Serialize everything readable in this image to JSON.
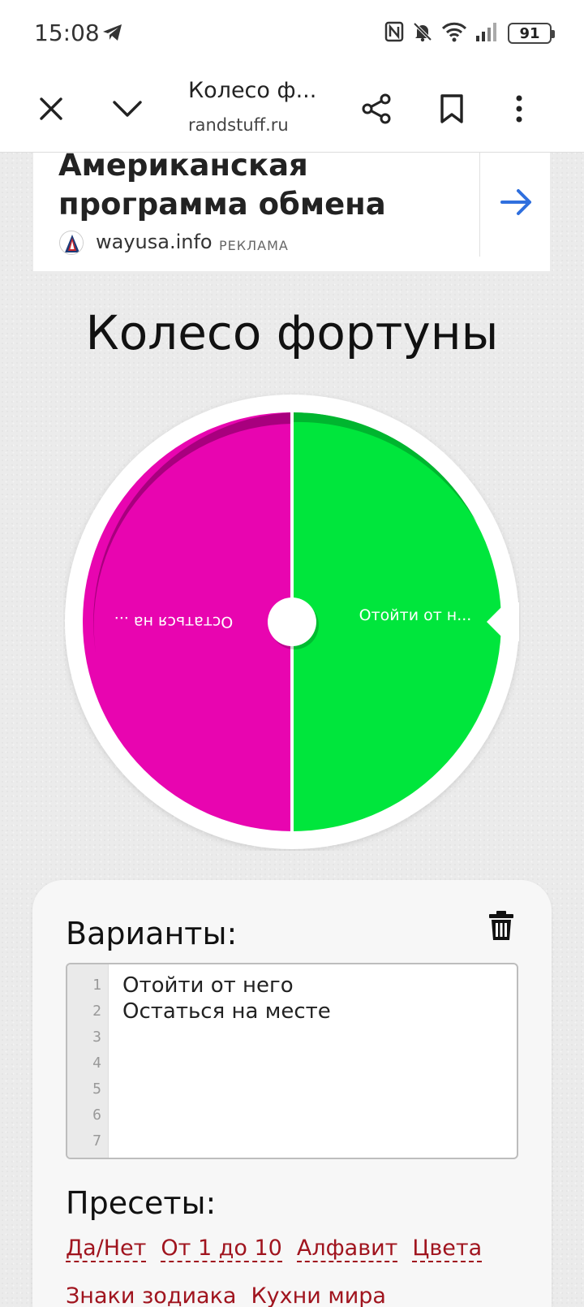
{
  "status_bar": {
    "time": "15:08",
    "battery": "91",
    "icons": [
      "telegram-icon",
      "nfc-icon",
      "bell-off-icon",
      "wifi-icon",
      "signal-icon",
      "battery-icon"
    ]
  },
  "browser": {
    "title": "Колесо ф...",
    "url": "randstuff.ru",
    "icons": [
      "close-icon",
      "chevron-down-icon",
      "share-icon",
      "bookmark-icon",
      "more-vert-icon"
    ]
  },
  "ad": {
    "title": "Американская программа обмена",
    "domain": "wayusa.info",
    "label": "РЕКЛАМА",
    "arrow_color": "#2f6fde"
  },
  "page": {
    "title": "Колесо фортуны"
  },
  "wheel": {
    "segments": [
      {
        "label": "Отойти от н...",
        "color": "#00e63c"
      },
      {
        "label": "Остаться на ...",
        "color": "#e805b0"
      }
    ]
  },
  "variants": {
    "heading": "Варианты:",
    "line_numbers": [
      "1",
      "2",
      "3",
      "4",
      "5",
      "6",
      "7"
    ],
    "lines": [
      "Отойти от него",
      "Остаться на месте"
    ]
  },
  "presets": {
    "heading": "Пресеты:",
    "items": [
      "Да/Нет",
      "От 1 до 10",
      "Алфавит",
      "Цвета",
      "Знаки зодиака",
      "Кухни мира"
    ],
    "link_color": "#a0141e"
  }
}
